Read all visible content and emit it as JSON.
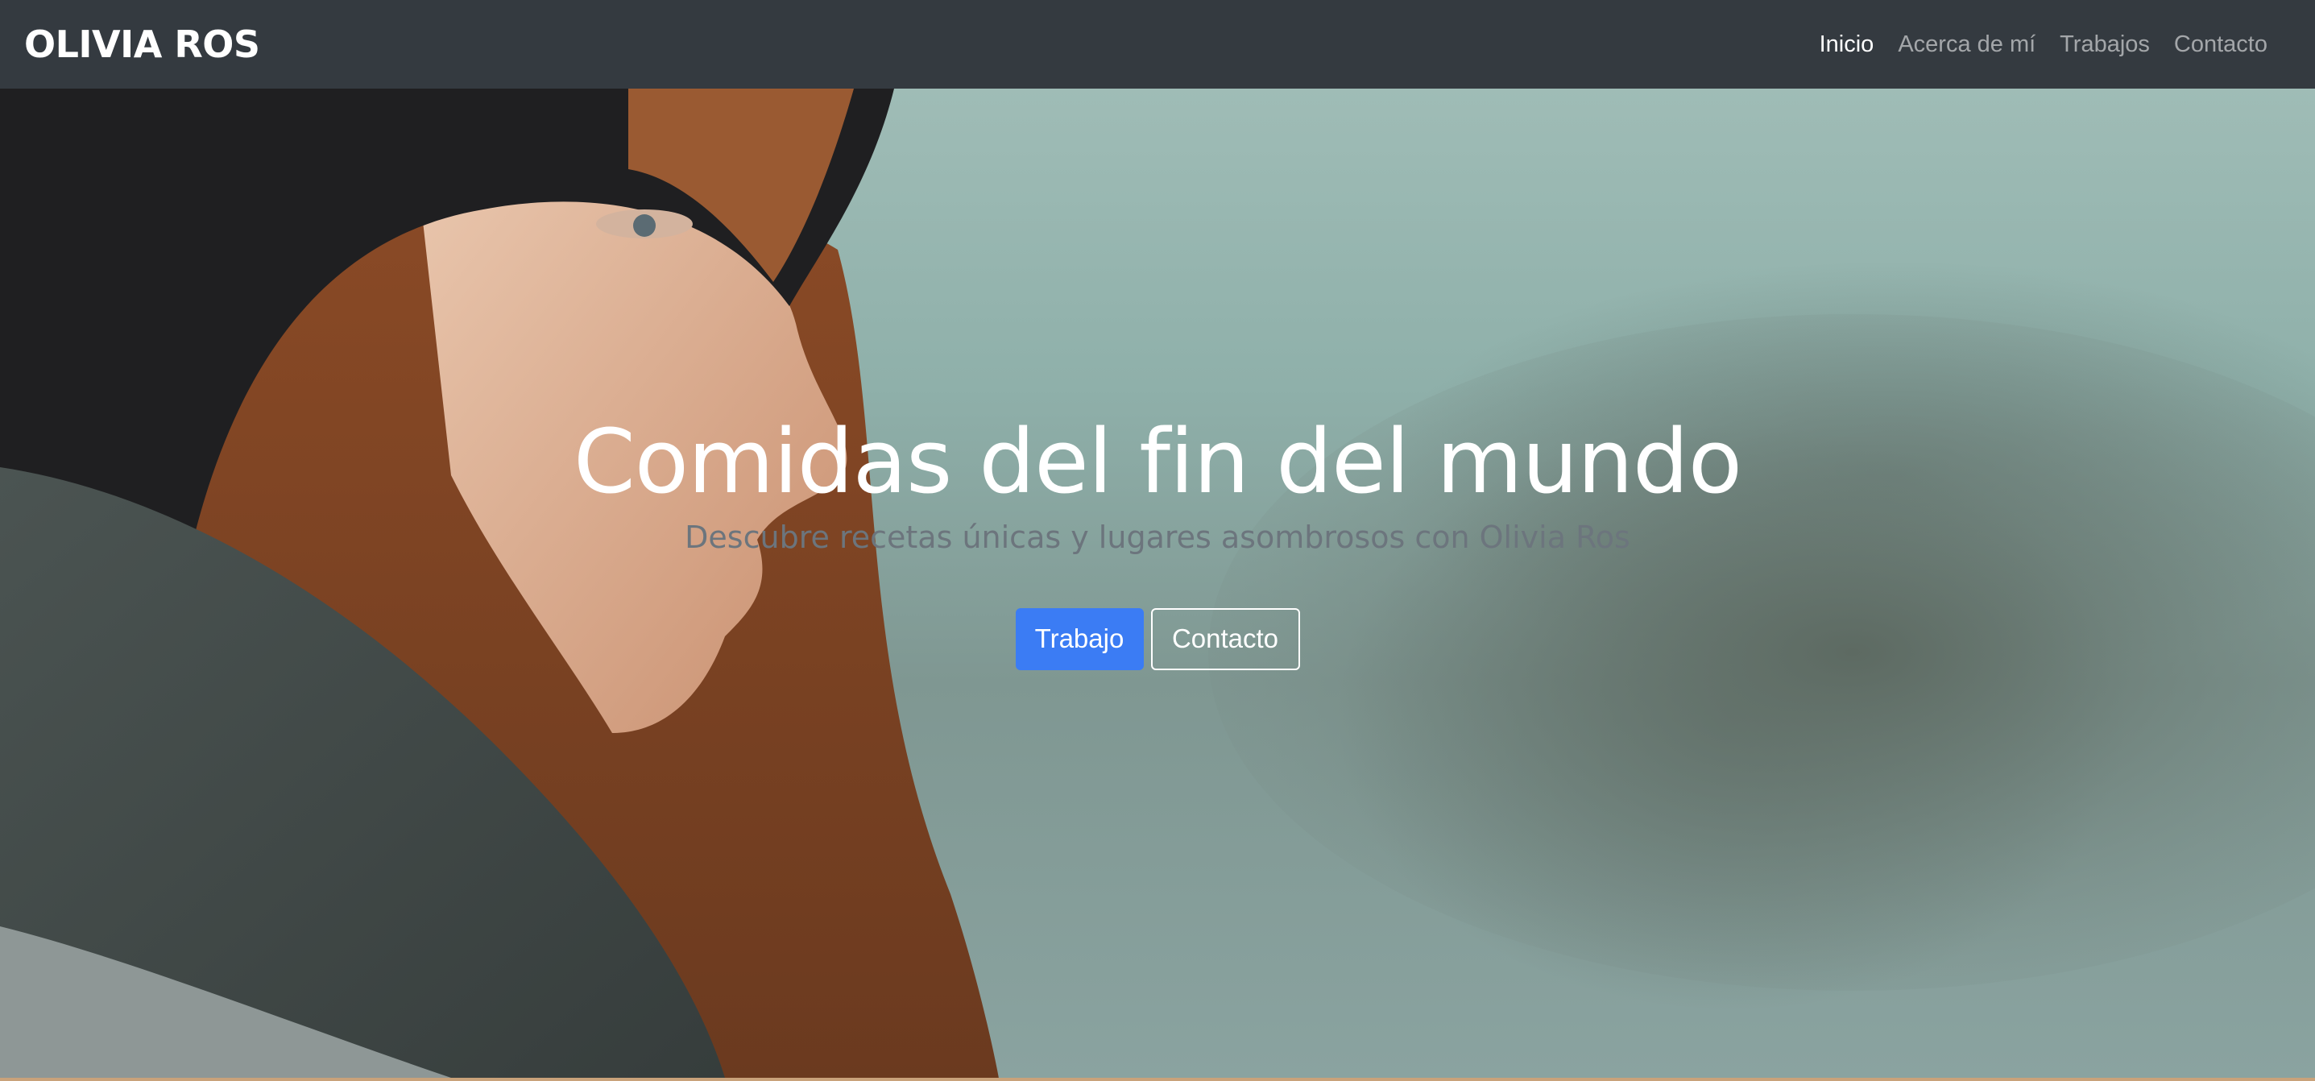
{
  "navbar": {
    "brand": "OLIVIA ROS",
    "links": [
      {
        "label": "Inicio",
        "active": true
      },
      {
        "label": "Acerca de mí",
        "active": false
      },
      {
        "label": "Trabajos",
        "active": false
      },
      {
        "label": "Contacto",
        "active": false
      }
    ]
  },
  "hero": {
    "title": "Comidas del fin del mundo",
    "subtitle": "Descubre recetas únicas y lugares asombrosos con Olivia Ros",
    "primary_button": "Trabajo",
    "secondary_button": "Contacto"
  },
  "colors": {
    "navbar_bg": "#343a40",
    "primary": "#3b7cf4",
    "subtitle": "#6c757d"
  }
}
